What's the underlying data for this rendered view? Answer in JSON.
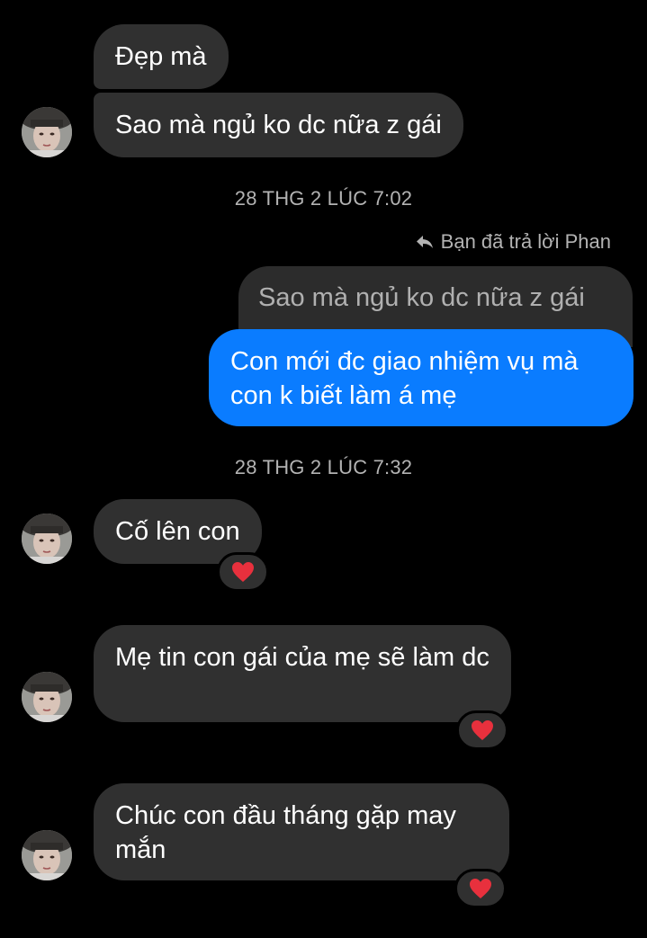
{
  "messages": {
    "m1": "Đẹp mà",
    "m2": "Sao mà ngủ ko dc nữa z gái",
    "reply_note": "Bạn đã trả lời Phan",
    "quoted": "Sao mà ngủ ko dc nữa z gái",
    "sent": "Con mới đc giao nhiệm vụ mà con k biết làm á mẹ",
    "m3": "Cố lên con",
    "m4": "Mẹ tin con gái của mẹ sẽ làm dc",
    "m5": "Chúc con đầu tháng gặp may mắn"
  },
  "timestamps": {
    "t1": "28 THG 2 LÚC 7:02",
    "t2": "28 THG 2 LÚC 7:32"
  },
  "icons": {
    "reply": "reply-arrow-icon",
    "reaction": "heart-icon",
    "avatar": "avatar"
  },
  "colors": {
    "background": "#000000",
    "incoming_bubble": "#303030",
    "outgoing_bubble": "#0a7cff",
    "meta_text": "#b3b3b3",
    "heart": "#e8303d"
  }
}
